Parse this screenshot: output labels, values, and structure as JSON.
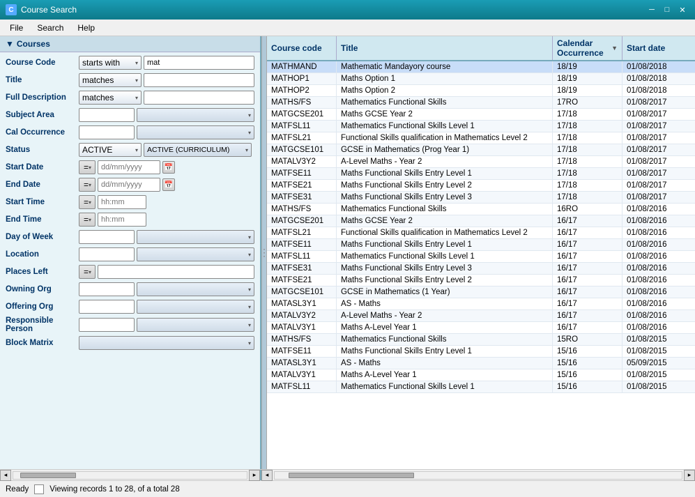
{
  "window": {
    "title": "Course Search",
    "icon": "C"
  },
  "menu": {
    "items": [
      "File",
      "Search",
      "Help"
    ]
  },
  "left_panel": {
    "header": "Courses",
    "fields": {
      "course_code_label": "Course Code",
      "course_code_op": "starts with",
      "course_code_val": "mat",
      "title_label": "Title",
      "title_op": "matches",
      "full_desc_label": "Full Description",
      "full_desc_op": "matches",
      "subject_area_label": "Subject Area",
      "cal_occurrence_label": "Cal Occurrence",
      "status_label": "Status",
      "status_val": "ACTIVE",
      "status_val2": "ACTIVE (CURRICULUM)",
      "start_date_label": "Start Date",
      "start_date_op": "=",
      "start_date_ph": "dd/mm/yyyy",
      "end_date_label": "End Date",
      "end_date_op": "=",
      "end_date_ph": "dd/mm/yyyy",
      "start_time_label": "Start Time",
      "start_time_op": "=",
      "start_time_ph": "hh:mm",
      "end_time_label": "End Time",
      "end_time_op": "=",
      "end_time_ph": "hh:mm",
      "day_of_week_label": "Day of Week",
      "location_label": "Location",
      "places_left_label": "Places Left",
      "places_left_op": "=",
      "owning_org_label": "Owning Org",
      "offering_org_label": "Offering Org",
      "responsible_person_label": "Responsible Person",
      "block_matrix_label": "Block Matrix"
    }
  },
  "table": {
    "columns": [
      "Course code",
      "Title",
      "Calendar Occurrence",
      "Start date"
    ],
    "sort_col": "Calendar Occurrence",
    "rows": [
      {
        "code": "MATHMAND",
        "title": "Mathematic Mandayory course",
        "calendar": "18/19",
        "start": "01/08/2018",
        "selected": true
      },
      {
        "code": "MATHOP1",
        "title": "Maths Option 1",
        "calendar": "18/19",
        "start": "01/08/2018"
      },
      {
        "code": "MATHOP2",
        "title": "Maths Option 2",
        "calendar": "18/19",
        "start": "01/08/2018"
      },
      {
        "code": "MATHS/FS",
        "title": "Mathematics Functional Skills",
        "calendar": "17RO",
        "start": "01/08/2017"
      },
      {
        "code": "MATGCSE201",
        "title": "Maths GCSE  Year 2",
        "calendar": "17/18",
        "start": "01/08/2017"
      },
      {
        "code": "MATFSL11",
        "title": "Mathematics Functional Skills Level 1",
        "calendar": "17/18",
        "start": "01/08/2017"
      },
      {
        "code": "MATFSL21",
        "title": "Functional Skills qualification in Mathematics Level 2",
        "calendar": "17/18",
        "start": "01/08/2017"
      },
      {
        "code": "MATGCSE101",
        "title": "GCSE in Mathematics (Prog Year 1)",
        "calendar": "17/18",
        "start": "01/08/2017"
      },
      {
        "code": "MATALV3Y2",
        "title": "A-Level Maths - Year 2",
        "calendar": "17/18",
        "start": "01/08/2017"
      },
      {
        "code": "MATFSE11",
        "title": "Maths Functional Skills Entry Level 1",
        "calendar": "17/18",
        "start": "01/08/2017"
      },
      {
        "code": "MATFSE21",
        "title": "Maths Functional Skills Entry Level 2",
        "calendar": "17/18",
        "start": "01/08/2017"
      },
      {
        "code": "MATFSE31",
        "title": "Maths Functional Skills Entry Level 3",
        "calendar": "17/18",
        "start": "01/08/2017"
      },
      {
        "code": "MATHS/FS",
        "title": "Mathematics Functional Skills",
        "calendar": "16RO",
        "start": "01/08/2016"
      },
      {
        "code": "MATGCSE201",
        "title": "Maths GCSE  Year 2",
        "calendar": "16/17",
        "start": "01/08/2016"
      },
      {
        "code": "MATFSL21",
        "title": "Functional Skills qualification in Mathematics Level 2",
        "calendar": "16/17",
        "start": "01/08/2016"
      },
      {
        "code": "MATFSE11",
        "title": "Maths Functional Skills Entry Level 1",
        "calendar": "16/17",
        "start": "01/08/2016"
      },
      {
        "code": "MATFSL11",
        "title": "Mathematics Functional Skills Level 1",
        "calendar": "16/17",
        "start": "01/08/2016"
      },
      {
        "code": "MATFSE31",
        "title": "Maths Functional Skills Entry Level 3",
        "calendar": "16/17",
        "start": "01/08/2016"
      },
      {
        "code": "MATFSE21",
        "title": "Maths Functional Skills Entry Level 2",
        "calendar": "16/17",
        "start": "01/08/2016"
      },
      {
        "code": "MATGCSE101",
        "title": "GCSE in Mathematics (1 Year)",
        "calendar": "16/17",
        "start": "01/08/2016"
      },
      {
        "code": "MATASL3Y1",
        "title": "AS - Maths",
        "calendar": "16/17",
        "start": "01/08/2016"
      },
      {
        "code": "MATALV3Y2",
        "title": "A-Level Maths - Year 2",
        "calendar": "16/17",
        "start": "01/08/2016"
      },
      {
        "code": "MATALV3Y1",
        "title": "Maths A-Level Year 1",
        "calendar": "16/17",
        "start": "01/08/2016"
      },
      {
        "code": "MATHS/FS",
        "title": "Mathematics Functional Skills",
        "calendar": "15RO",
        "start": "01/08/2015"
      },
      {
        "code": "MATFSE11",
        "title": "Maths Functional Skills Entry Level 1",
        "calendar": "15/16",
        "start": "01/08/2015"
      },
      {
        "code": "MATASL3Y1",
        "title": "AS - Maths",
        "calendar": "15/16",
        "start": "05/09/2015"
      },
      {
        "code": "MATALV3Y1",
        "title": "Maths A-Level Year 1",
        "calendar": "15/16",
        "start": "01/08/2015"
      },
      {
        "code": "MATFSL11",
        "title": "Mathematics Functional Skills Level 1",
        "calendar": "15/16",
        "start": "01/08/2015"
      }
    ]
  },
  "status_bar": {
    "status": "Ready",
    "message": "Viewing records 1 to 28, of a total 28"
  },
  "icons": {
    "triangle_down": "▼",
    "triangle_right": "▶",
    "minimize": "─",
    "maximize": "□",
    "close": "✕",
    "arrow_down": "▾",
    "arrow_up": "▴",
    "arrow_left": "◂",
    "arrow_right": "▸",
    "sort_desc": "▼",
    "calendar": "📅"
  }
}
